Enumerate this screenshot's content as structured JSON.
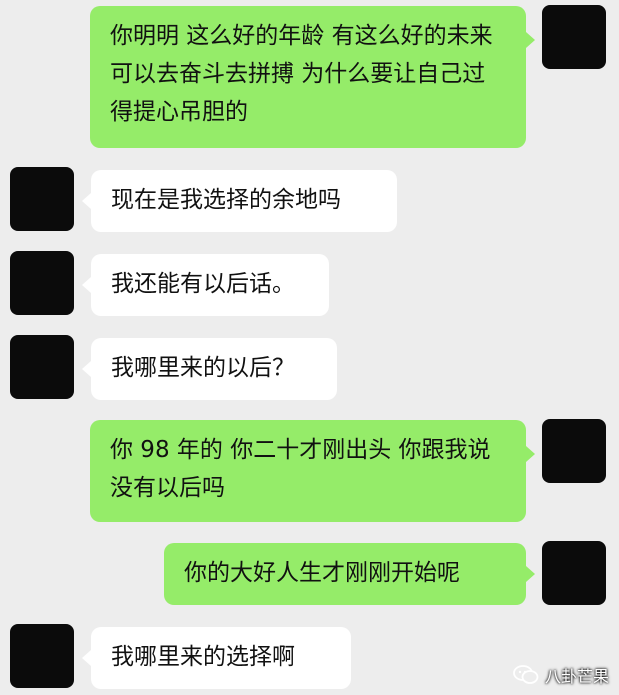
{
  "messages": [
    {
      "side": "right",
      "text": "你明明 这么好的年龄 有这么好的未来 可以去奋斗去拼搏 为什么要让自己过得提心吊胆的"
    },
    {
      "side": "left",
      "text": "现在是我选择的余地吗"
    },
    {
      "side": "left",
      "text": "我还能有以后话。"
    },
    {
      "side": "left",
      "text": "我哪里来的以后？"
    },
    {
      "side": "right",
      "text": "你 98 年的 你二十才刚出头 你跟我说没有以后吗"
    },
    {
      "side": "right",
      "text": "你的大好人生才刚刚开始呢"
    },
    {
      "side": "left",
      "text": "我哪里来的选择啊"
    }
  ],
  "watermark": {
    "icon": "wechat-icon",
    "text": "八卦芒果"
  },
  "colors": {
    "me_bubble": "#95ec69",
    "other_bubble": "#ffffff",
    "background": "#ededed",
    "avatar": "#0b0b0b"
  }
}
